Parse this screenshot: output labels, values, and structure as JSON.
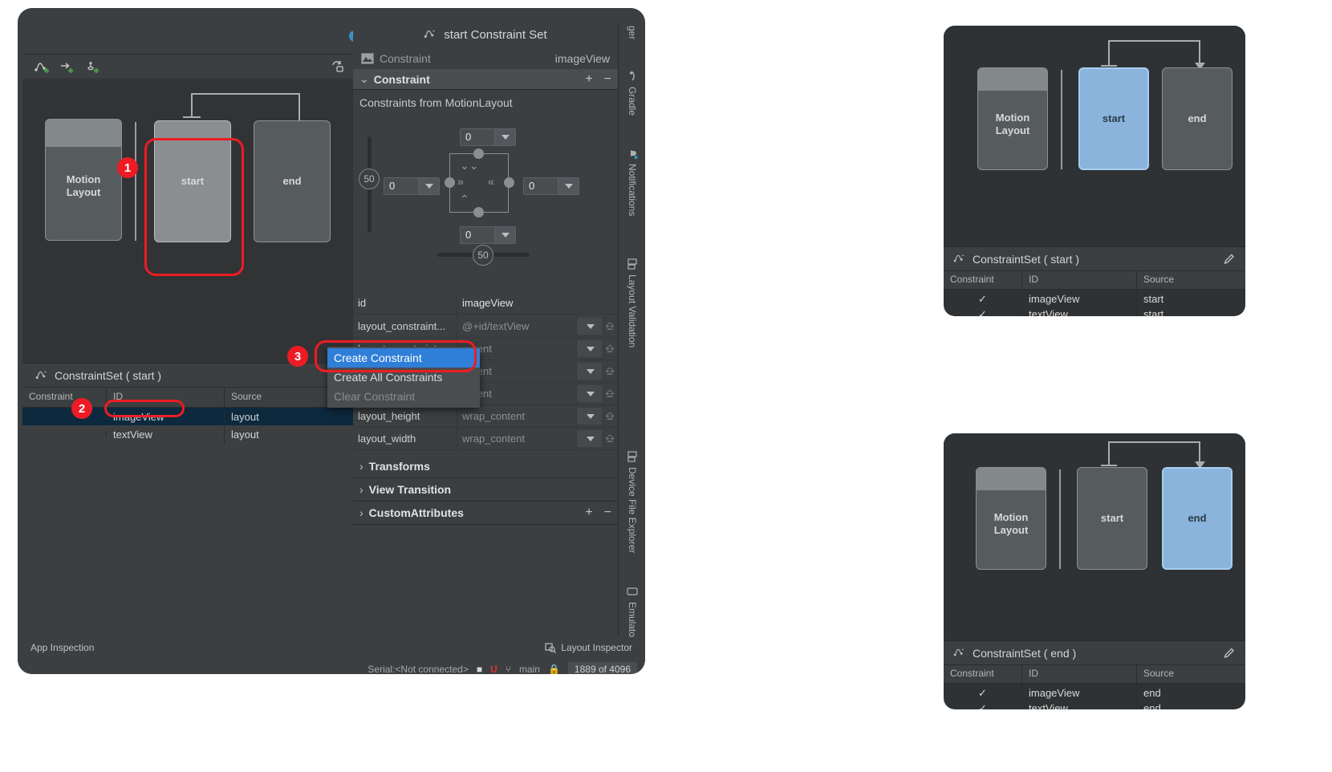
{
  "ide": {
    "help_icon": "help-icon",
    "toolbar": {
      "icons": [
        "add-transition-icon",
        "add-constraint-set-icon",
        "add-onclick-icon",
        "sync-icon"
      ]
    },
    "motion_editor": {
      "nodes": [
        {
          "label": "Motion\nLayout",
          "type": "motion-layout"
        },
        {
          "label": "start",
          "type": "constraint-set",
          "selected": true
        },
        {
          "label": "end",
          "type": "constraint-set",
          "selected": false
        }
      ]
    },
    "constraint_set_panel": {
      "title": "ConstraintSet (  start  )",
      "columns": [
        "Constraint",
        "ID",
        "Source"
      ],
      "rows": [
        {
          "constraint": "",
          "id": "imageView",
          "source": "layout",
          "selected": true
        },
        {
          "constraint": "",
          "id": "textView",
          "source": "layout",
          "selected": false
        }
      ]
    },
    "attributes": {
      "title": "start Constraint Set",
      "subtitle_label": "Constraint",
      "subtitle_value": "imageView",
      "section_title": "Constraint",
      "section_add": "+",
      "section_remove": "−",
      "note": "Constraints from MotionLayout",
      "widget": {
        "top_margin": "0",
        "left_margin": "0",
        "right_margin": "0",
        "bottom_margin": "0",
        "vertical_bias": "50",
        "horizontal_bias": "50"
      },
      "rows": [
        {
          "key": "id",
          "value": "imageView",
          "has_dropdown": false,
          "has_pin": false
        },
        {
          "key": "layout_constraint...",
          "value": "@+id/textView",
          "has_dropdown": true,
          "has_pin": true
        },
        {
          "key": "layout_constraint...",
          "value": "parent",
          "has_dropdown": true,
          "has_pin": true
        },
        {
          "key": "layout_constraint...",
          "value": "parent",
          "has_dropdown": true,
          "has_pin": true
        },
        {
          "key": "layout_constraint...",
          "value": "parent",
          "has_dropdown": true,
          "has_pin": true
        },
        {
          "key": "layout_height",
          "value": "wrap_content",
          "has_dropdown": true,
          "has_pin": true
        },
        {
          "key": "layout_width",
          "value": "wrap_content",
          "has_dropdown": true,
          "has_pin": true
        }
      ],
      "expanders": [
        {
          "label": "Transforms",
          "plus": "",
          "minus": ""
        },
        {
          "label": "View Transition",
          "plus": "",
          "minus": ""
        },
        {
          "label": "CustomAttributes",
          "plus": "+",
          "minus": "−"
        }
      ]
    },
    "context_menu": {
      "items": [
        {
          "label": "Create Constraint",
          "state": "highlighted"
        },
        {
          "label": "Create All Constraints",
          "state": "normal"
        },
        {
          "label": "Clear Constraint",
          "state": "disabled"
        }
      ]
    },
    "vertical_tabs": [
      {
        "label": "ger",
        "icon": ""
      },
      {
        "label": "Gradle",
        "icon": "gradle-icon"
      },
      {
        "label": "Notifications",
        "icon": "bell-icon"
      },
      {
        "label": "Layout Validation",
        "icon": "layout-validation-icon"
      },
      {
        "label": "Device File Explorer",
        "icon": "device-file-explorer-icon"
      },
      {
        "label": "Emulator",
        "icon": "emulator-icon"
      }
    ],
    "bottom_strip": {
      "left_label": "App Inspection",
      "right_label": "Layout Inspector",
      "right_icon": "layout-inspector-icon"
    },
    "status_bar": {
      "serial": "Serial:<Not connected>",
      "branch": "main",
      "memory": "1889 of 4096",
      "icons": [
        "warning-icon",
        "u-icon",
        "branch-icon",
        "lock-icon"
      ]
    }
  },
  "cards": [
    {
      "id": "card-start",
      "nodes": [
        {
          "label": "Motion\nLayout",
          "type": "motion-layout"
        },
        {
          "label": "start",
          "type": "constraint-set",
          "selected": true
        },
        {
          "label": "end",
          "type": "constraint-set",
          "selected": false
        }
      ],
      "header": "ConstraintSet (  start  )",
      "edit_icon": "pencil-icon",
      "columns": [
        "Constraint",
        "ID",
        "Source"
      ],
      "rows": [
        {
          "constraint": "✓",
          "id": "imageView",
          "source": "start"
        },
        {
          "constraint": "✓",
          "id": "textView",
          "source": "start"
        }
      ]
    },
    {
      "id": "card-end",
      "nodes": [
        {
          "label": "Motion\nLayout",
          "type": "motion-layout"
        },
        {
          "label": "start",
          "type": "constraint-set",
          "selected": false
        },
        {
          "label": "end",
          "type": "constraint-set",
          "selected": true
        }
      ],
      "header": "ConstraintSet (  end  )",
      "edit_icon": "pencil-icon",
      "columns": [
        "Constraint",
        "ID",
        "Source"
      ],
      "rows": [
        {
          "constraint": "✓",
          "id": "imageView",
          "source": "end"
        },
        {
          "constraint": "✓",
          "id": "textView",
          "source": "end"
        }
      ]
    }
  ],
  "annotations": {
    "markers": [
      {
        "number": "1",
        "target": "start-constraint-set-node"
      },
      {
        "number": "2",
        "target": "imageview-row-id-cell"
      },
      {
        "number": "3",
        "target": "create-constraint-menu-item"
      }
    ]
  },
  "colors": {
    "accent_red": "#ed1c24",
    "accent_blue": "#2f7fd8",
    "selected_node": "#8ab4dc",
    "panel_bg": "#3c3f41",
    "canvas_bg": "#313335"
  }
}
